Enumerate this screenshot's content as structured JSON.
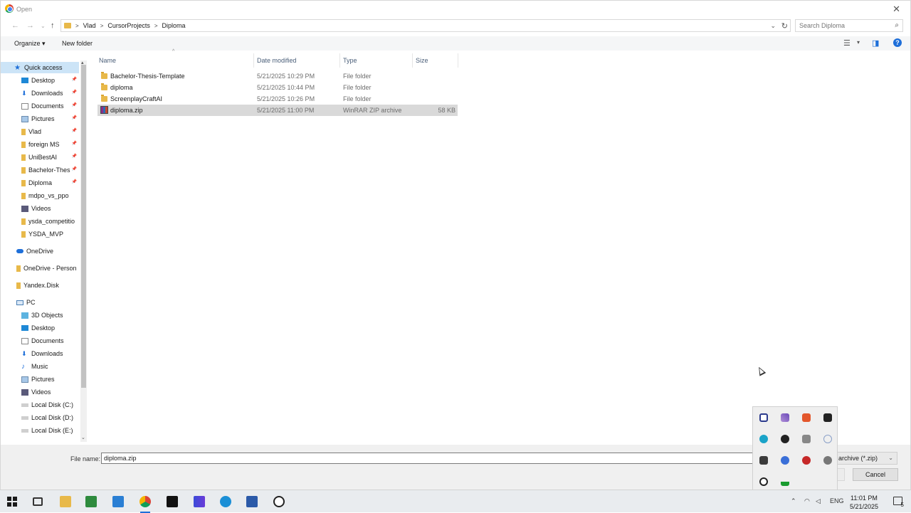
{
  "window": {
    "title": "Open"
  },
  "address": {
    "crumbs": [
      "Vlad",
      "CursorProjects",
      "Diploma"
    ],
    "search_placeholder": "Search Diploma"
  },
  "toolbar": {
    "organize": "Organize ▾",
    "new_folder": "New folder"
  },
  "columns": {
    "name": "Name",
    "date": "Date modified",
    "type": "Type",
    "size": "Size"
  },
  "files": [
    {
      "name": "Bachelor-Thesis-Template",
      "date": "5/21/2025 10:29 PM",
      "type": "File folder",
      "size": "",
      "icon": "folder-icon"
    },
    {
      "name": "diploma",
      "date": "5/21/2025 10:44 PM",
      "type": "File folder",
      "size": "",
      "icon": "folder-icon"
    },
    {
      "name": "ScreenplayCraftAI",
      "date": "5/21/2025 10:26 PM",
      "type": "File folder",
      "size": "",
      "icon": "folder-icon"
    },
    {
      "name": "diploma.zip",
      "date": "5/21/2025 11:00 PM",
      "type": "WinRAR ZIP archive",
      "size": "58 KB",
      "icon": "zip-archive-icon",
      "selected": true
    }
  ],
  "nav": {
    "quick_access": "Quick access",
    "items": [
      {
        "label": "Desktop",
        "pinned": true,
        "icon": "desktop-icon"
      },
      {
        "label": "Downloads",
        "pinned": true,
        "icon": "download-icon"
      },
      {
        "label": "Documents",
        "pinned": true,
        "icon": "documents-icon"
      },
      {
        "label": "Pictures",
        "pinned": true,
        "icon": "pictures-icon"
      },
      {
        "label": "Vlad",
        "pinned": true,
        "icon": "folder-icon"
      },
      {
        "label": "foreign MS",
        "pinned": true,
        "icon": "folder-icon"
      },
      {
        "label": "UniBestAI",
        "pinned": true,
        "icon": "folder-icon"
      },
      {
        "label": "Bachelor-Thes",
        "pinned": true,
        "icon": "folder-icon"
      },
      {
        "label": "Diploma",
        "pinned": true,
        "icon": "folder-icon"
      },
      {
        "label": "mdpo_vs_ppo",
        "pinned": false,
        "icon": "folder-icon"
      },
      {
        "label": "Videos",
        "pinned": false,
        "icon": "videos-icon"
      },
      {
        "label": "ysda_competitio",
        "pinned": false,
        "icon": "folder-icon"
      },
      {
        "label": "YSDA_MVP",
        "pinned": false,
        "icon": "folder-icon"
      }
    ],
    "onedrive": "OneDrive",
    "onedrive_personal": "OneDrive - Person",
    "yandex_disk": "Yandex.Disk",
    "pc": "PC",
    "pc_items": [
      {
        "label": "3D Objects",
        "icon": "3d-objects-icon"
      },
      {
        "label": "Desktop",
        "icon": "desktop-icon"
      },
      {
        "label": "Documents",
        "icon": "documents-icon"
      },
      {
        "label": "Downloads",
        "icon": "download-icon"
      },
      {
        "label": "Music",
        "icon": "music-icon"
      },
      {
        "label": "Pictures",
        "icon": "pictures-icon"
      },
      {
        "label": "Videos",
        "icon": "videos-icon"
      },
      {
        "label": "Local Disk (C:)",
        "icon": "disk-icon"
      },
      {
        "label": "Local Disk (D:)",
        "icon": "disk-icon"
      },
      {
        "label": "Local Disk (E:)",
        "icon": "disk-icon"
      }
    ]
  },
  "footer": {
    "filename_label": "File name:",
    "filename_value": "diploma.zip",
    "filetype_visible": "archive (*.zip)",
    "cancel": "Cancel"
  },
  "taskbar": {
    "language": "ENG",
    "time": "11:01 PM",
    "date": "5/21/2025",
    "notification_count": "5"
  },
  "colors": {
    "selection": "#d9d9d9",
    "nav_selection": "#cce4f7",
    "folder": "#e8b94a",
    "accent": "#1e6fd9"
  }
}
